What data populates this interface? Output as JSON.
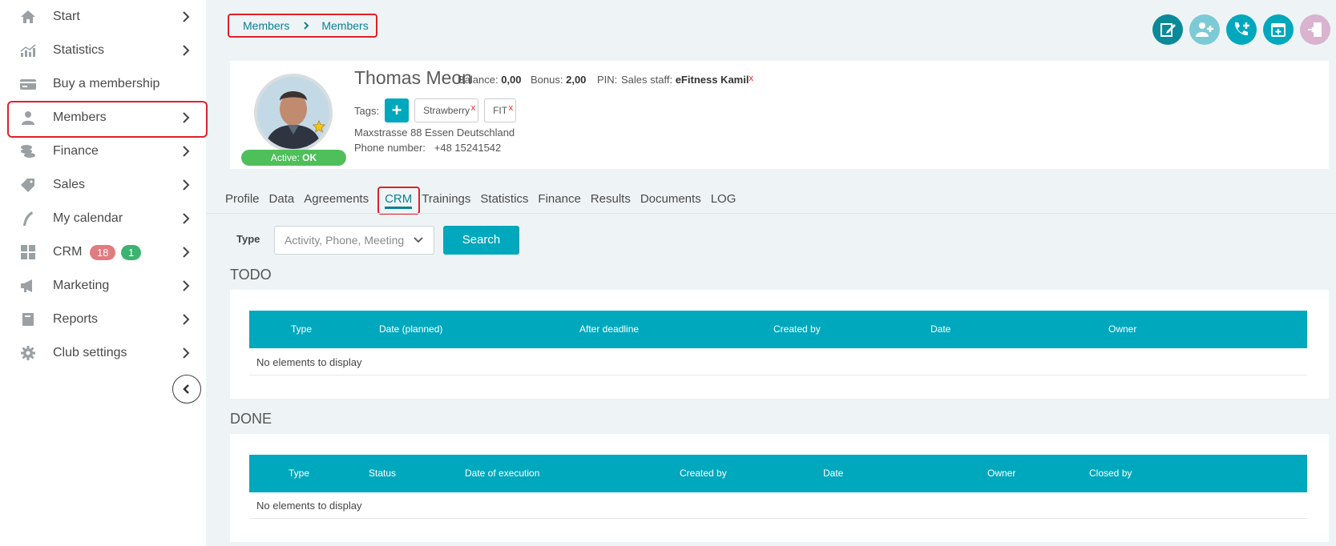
{
  "sidebar": {
    "items": [
      {
        "label": "Start",
        "icon": "home-icon"
      },
      {
        "label": "Statistics",
        "icon": "chart-icon"
      },
      {
        "label": "Buy a membership",
        "icon": "card-icon"
      },
      {
        "label": "Members",
        "icon": "person-icon"
      },
      {
        "label": "Finance",
        "icon": "coins-icon"
      },
      {
        "label": "Sales",
        "icon": "tag-icon"
      },
      {
        "label": "My calendar",
        "icon": "calendar-icon"
      },
      {
        "label": "CRM",
        "icon": "grid-icon",
        "badges": [
          "18",
          "1"
        ]
      },
      {
        "label": "Marketing",
        "icon": "megaphone-icon"
      },
      {
        "label": "Reports",
        "icon": "book-icon"
      },
      {
        "label": "Club settings",
        "icon": "gear-icon"
      }
    ]
  },
  "breadcrumb": [
    "Members",
    "Members"
  ],
  "member": {
    "name": "Thomas Meon",
    "balance_label": "Balance:",
    "balance": "0,00",
    "bonus_label": "Bonus:",
    "bonus": "2,00",
    "pin_label": "PIN:",
    "staff_label": "Sales staff:",
    "staff": "eFitness Kamil",
    "status_label": "Active:",
    "status": "OK",
    "tags_label": "Tags:",
    "tags": [
      "Strawberry",
      "FIT"
    ],
    "address": "Maxstrasse 88 Essen Deutschland",
    "phone_label": "Phone number:",
    "phone": "+48 15241542"
  },
  "tabs": [
    "Profile",
    "Data",
    "Agreements",
    "CRM",
    "Trainings",
    "Statistics",
    "Finance",
    "Results",
    "Documents",
    "LOG"
  ],
  "active_tab": "CRM",
  "filter": {
    "type_label": "Type",
    "type_placeholder": "Activity, Phone, Meeting",
    "search_label": "Search"
  },
  "todo": {
    "title": "TODO",
    "columns": [
      "Type",
      "Date (planned)",
      "After deadline",
      "Created by",
      "Date",
      "Owner"
    ],
    "empty": "No elements to display"
  },
  "done": {
    "title": "DONE",
    "columns": [
      "Type",
      "Status",
      "Date of execution",
      "Created by",
      "Date",
      "Owner",
      "Closed by"
    ],
    "empty": "No elements to display"
  },
  "colors": {
    "accent": "#00a8bd",
    "highlight": "#e0202a",
    "active_green": "#4fbf5a"
  }
}
